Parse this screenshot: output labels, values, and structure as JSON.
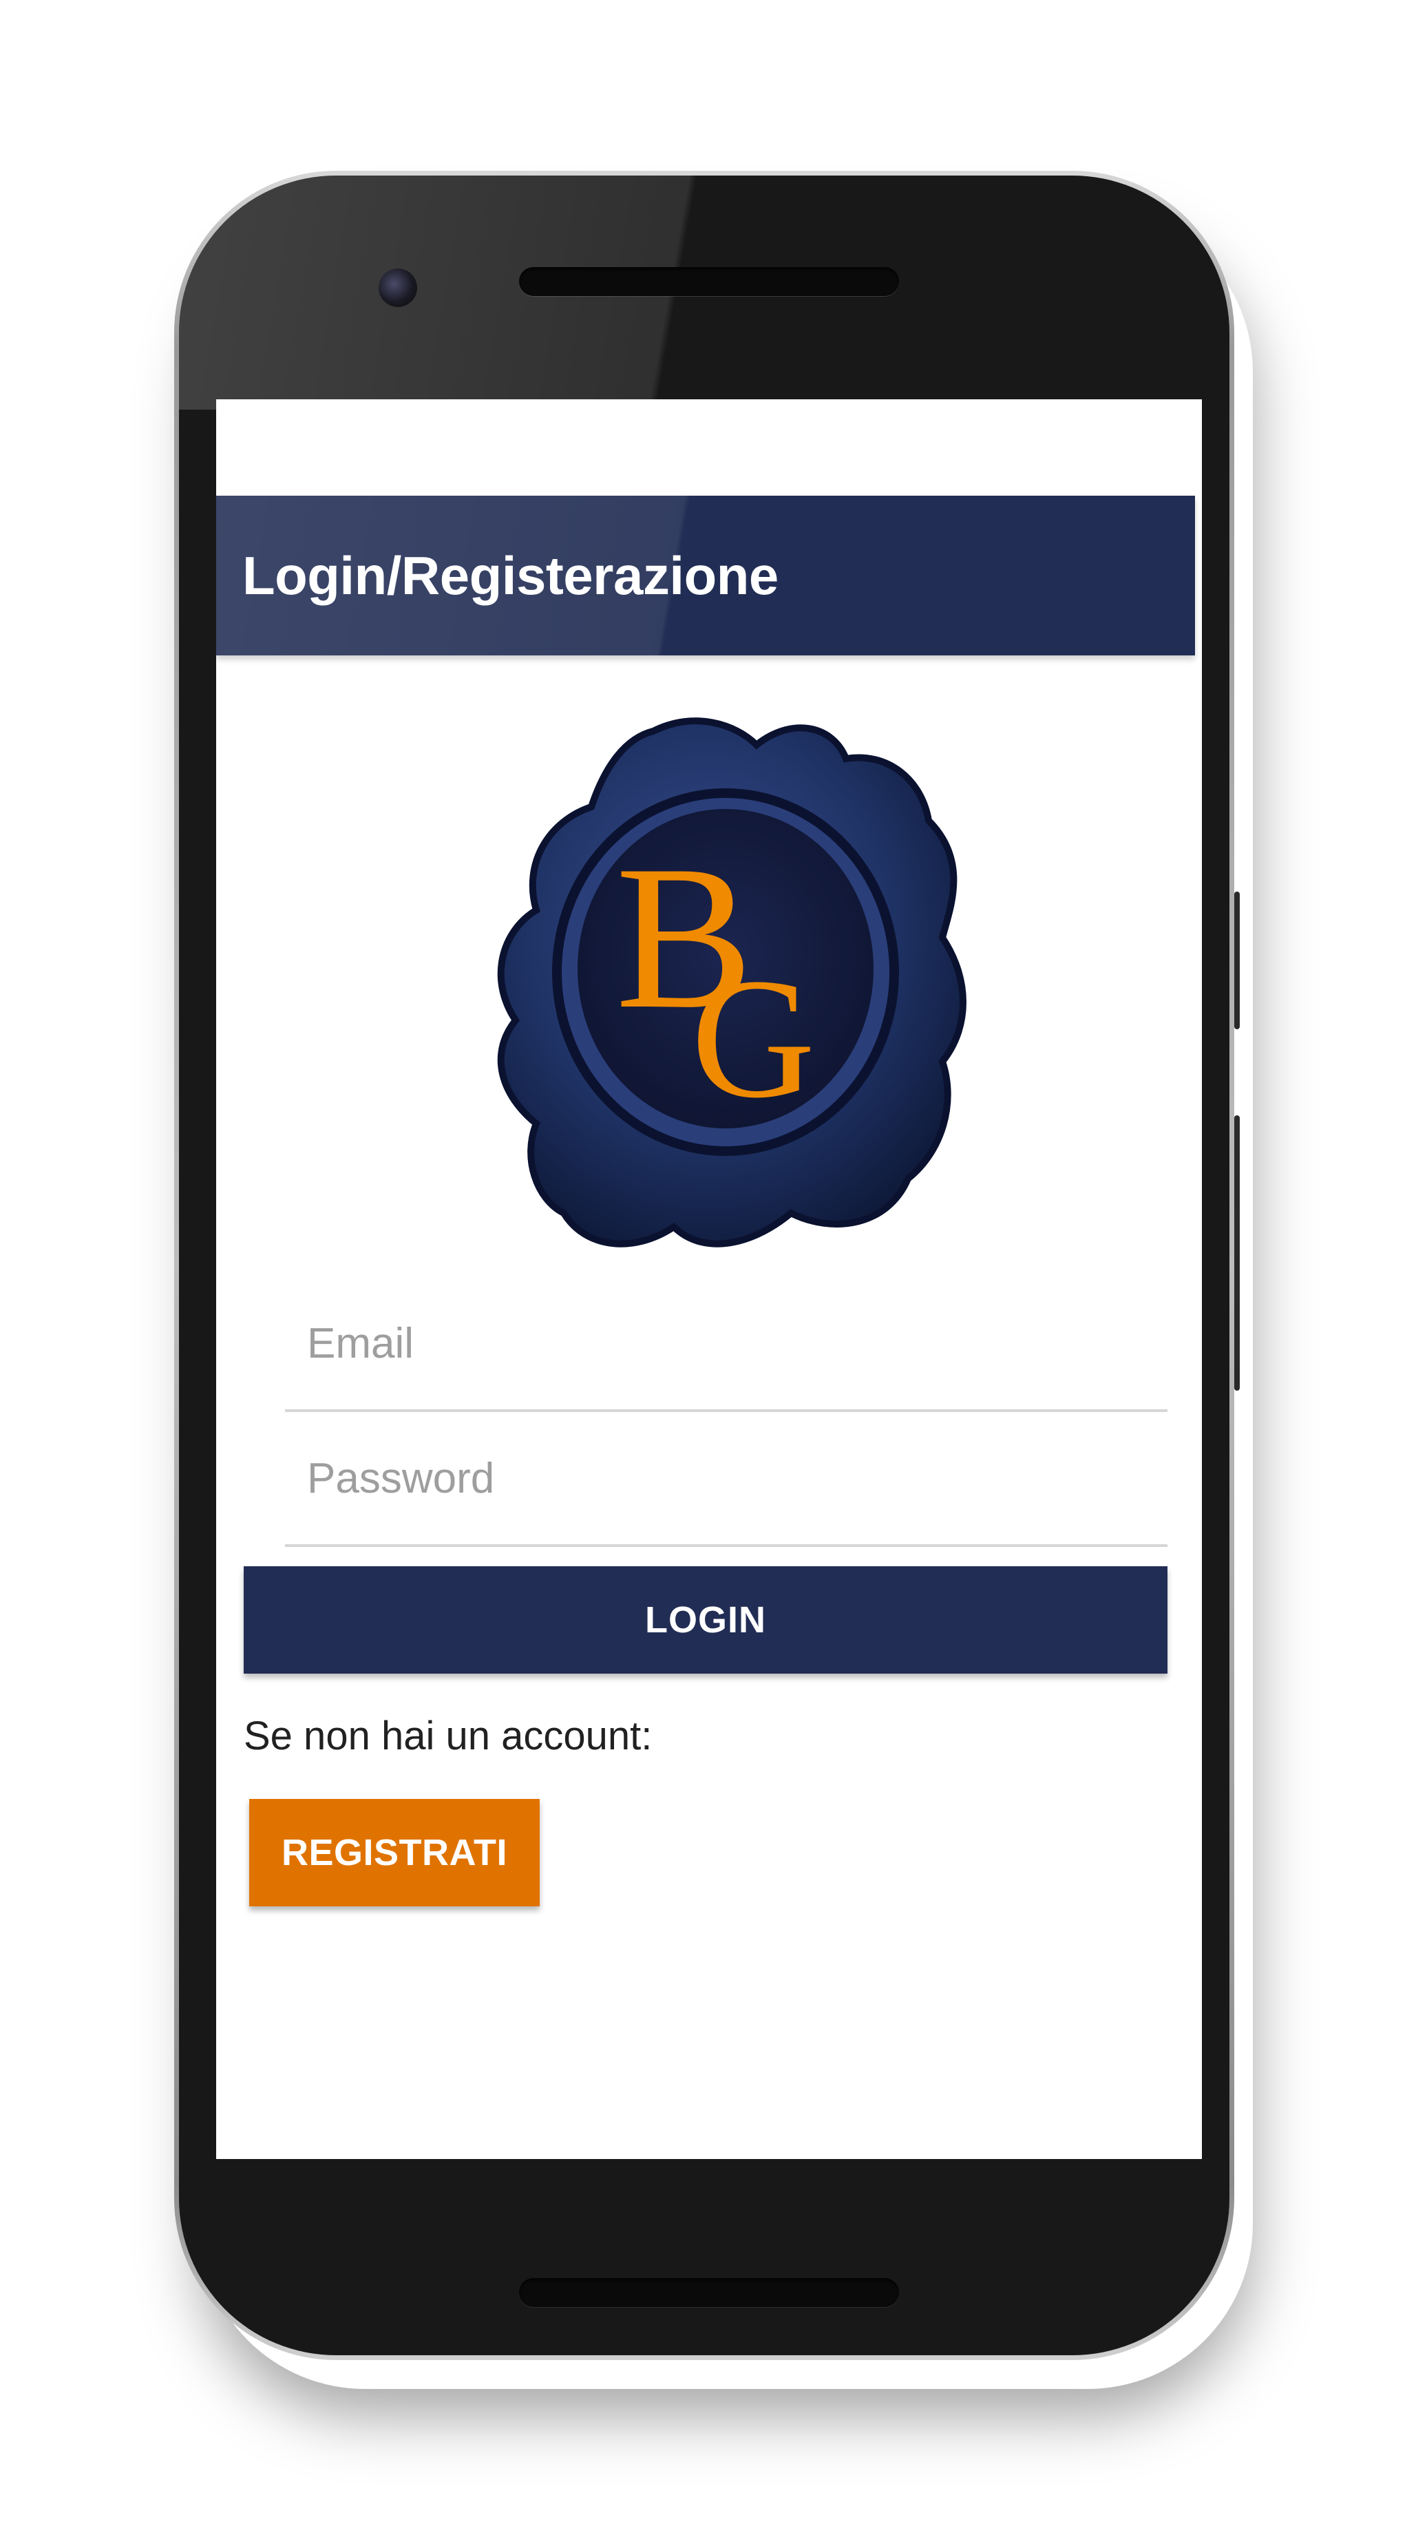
{
  "app_bar": {
    "title": "Login/Registerazione"
  },
  "logo": {
    "monogram_1": "B",
    "monogram_2": "G",
    "colors": {
      "seal": "#1f3366",
      "seal_dark": "#121a36",
      "letters": "#f08a00"
    }
  },
  "form": {
    "email": {
      "placeholder": "Email",
      "value": ""
    },
    "password": {
      "placeholder": "Password",
      "value": ""
    },
    "login_label": "LOGIN"
  },
  "register": {
    "prompt": "Se non hai un account:",
    "button_label": "REGISTRATI"
  },
  "colors": {
    "primary": "#212d54",
    "accent": "#e07300",
    "background": "#ffffff"
  }
}
